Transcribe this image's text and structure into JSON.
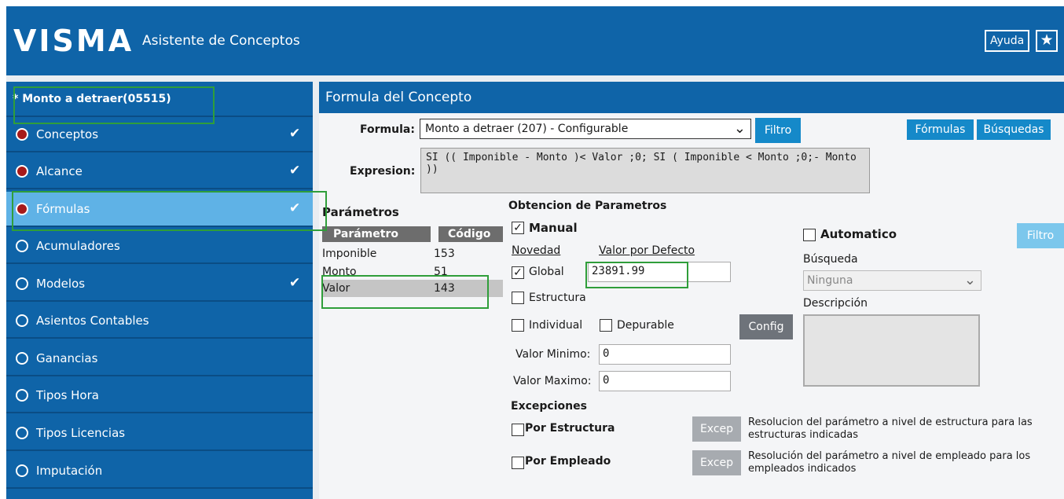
{
  "header": {
    "logo": "VISMA",
    "title": "Asistente de Conceptos",
    "help_label": "Ayuda",
    "star_icon": "star-icon"
  },
  "sidebar": {
    "concept": "* Monto a detraer(05515)",
    "items": [
      {
        "label": "Conceptos",
        "status": "filled",
        "checked": true
      },
      {
        "label": "Alcance",
        "status": "filled",
        "checked": true
      },
      {
        "label": "Fórmulas",
        "status": "filled",
        "checked": true,
        "active": true
      },
      {
        "label": "Acumuladores",
        "status": "empty",
        "checked": false
      },
      {
        "label": "Modelos",
        "status": "empty",
        "checked": true
      },
      {
        "label": "Asientos Contables",
        "status": "empty",
        "checked": false
      },
      {
        "label": "Ganancias",
        "status": "empty",
        "checked": false
      },
      {
        "label": "Tipos Hora",
        "status": "empty",
        "checked": false
      },
      {
        "label": "Tipos Licencias",
        "status": "empty",
        "checked": false
      },
      {
        "label": "Imputación",
        "status": "empty",
        "checked": false
      }
    ]
  },
  "main": {
    "header": "Formula del Concepto",
    "formula_label": "Formula:",
    "formula_value": "Monto a detraer (207) - Configurable",
    "filtro_label": "Filtro",
    "formulas_btn": "Fórmulas",
    "busquedas_btn": "Búsquedas",
    "expresion_label": "Expresion:",
    "expresion_value": "SI (( Imponible - Monto )< Valor ;0; SI ( Imponible < Monto ;0;- Monto ))",
    "parametros_title": "Parámetros",
    "params_table": {
      "headers": [
        "Parámetro",
        "Código"
      ],
      "rows": [
        {
          "param": "Imponible",
          "code": "153"
        },
        {
          "param": "Monto",
          "code": "51"
        },
        {
          "param": "Valor",
          "code": "143",
          "selected": true
        }
      ]
    },
    "obtencion_title": "Obtencion de Parametros",
    "manual_label": "Manual",
    "manual_checked": true,
    "novedad_label": "Novedad",
    "valor_defecto_label": "Valor por Defecto",
    "valor_defecto_value": "23891.99",
    "global_label": "Global",
    "global_checked": true,
    "estructura_label": "Estructura",
    "individual_label": "Individual",
    "depurable_label": "Depurable",
    "config_btn": "Config",
    "valor_minimo_label": "Valor Minimo:",
    "valor_minimo_value": "0",
    "valor_maximo_label": "Valor Maximo:",
    "valor_maximo_value": "0",
    "automatico_label": "Automatico",
    "busqueda_label": "Búsqueda",
    "busqueda_value": "Ninguna",
    "descripcion_label": "Descripción",
    "filtro2_label": "Filtro",
    "excepciones_title": "Excepciones",
    "por_estructura_label": "Por Estructura",
    "por_empleado_label": "Por Empleado",
    "excep_btn": "Excep",
    "excep_estructura_desc_1": "Resolucion del parámetro a nivel de estructura para las",
    "excep_estructura_desc_2": "estructuras indicadas",
    "excep_empleado_desc_1": "Resolución del parámetro a nivel de empleado para los",
    "excep_empleado_desc_2": "empleados indicados"
  },
  "colors": {
    "brand_blue": "#0f64a8",
    "active_item": "#5fb2e6",
    "status_red": "#a61a1a",
    "highlight_green": "#2f9e3a"
  }
}
